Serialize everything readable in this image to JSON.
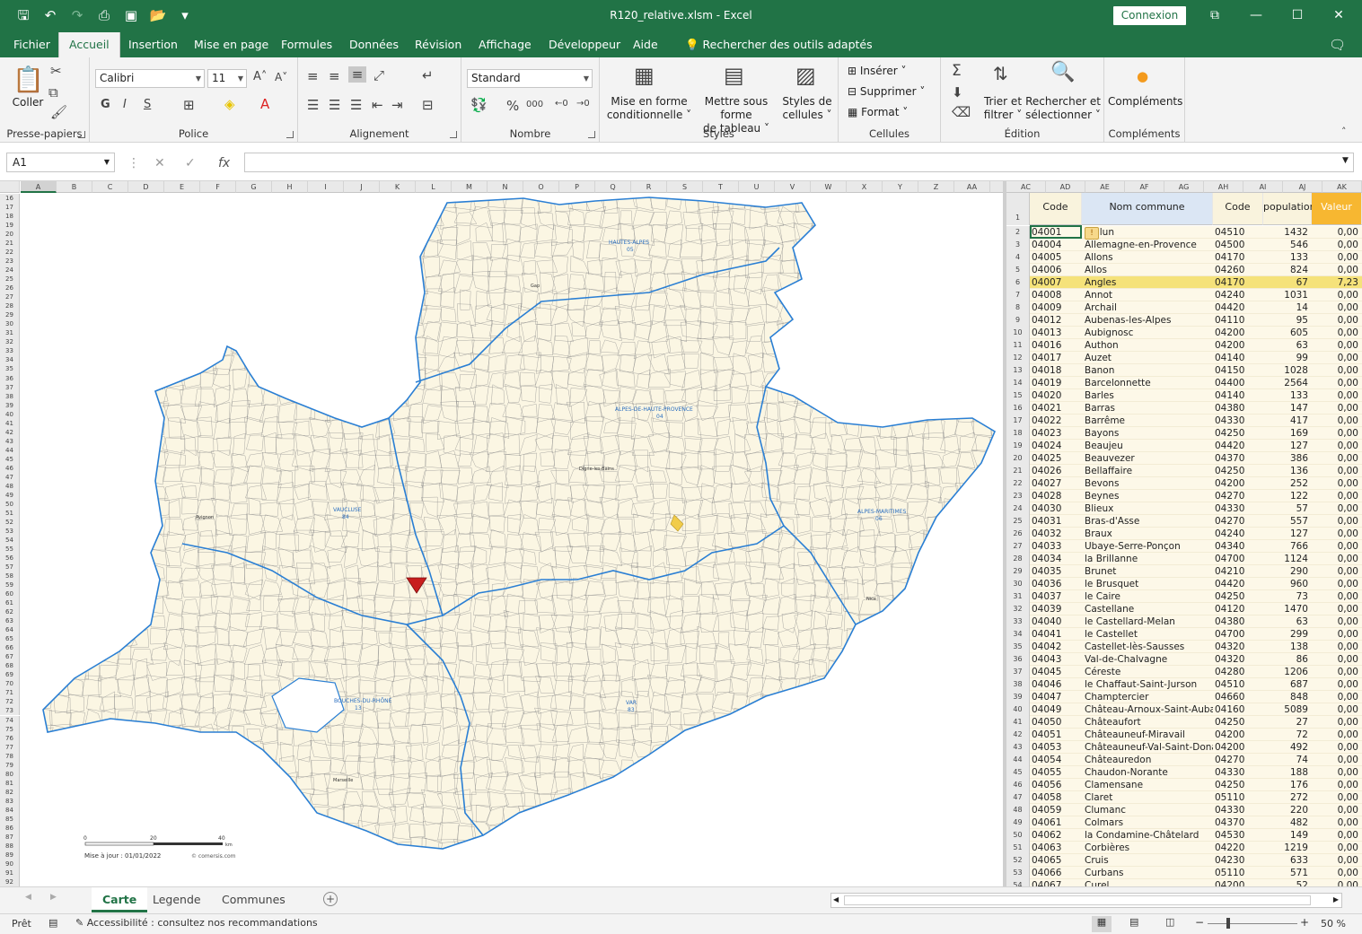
{
  "window": {
    "title": "R120_relative.xlsm  -  Excel",
    "connexion_label": "Connexion",
    "controls": [
      "⧉",
      "—",
      "☐",
      "✕"
    ]
  },
  "qat": [
    "save-icon",
    "undo-icon",
    "redo-icon",
    "print-preview-icon",
    "save-as-icon",
    "open-icon",
    "customize-icon"
  ],
  "tabs": [
    {
      "label": "Fichier",
      "active": false
    },
    {
      "label": "Accueil",
      "active": true
    },
    {
      "label": "Insertion",
      "active": false
    },
    {
      "label": "Mise en page",
      "active": false
    },
    {
      "label": "Formules",
      "active": false
    },
    {
      "label": "Données",
      "active": false
    },
    {
      "label": "Révision",
      "active": false
    },
    {
      "label": "Affichage",
      "active": false
    },
    {
      "label": "Développeur",
      "active": false
    },
    {
      "label": "Aide",
      "active": false
    }
  ],
  "search_tools": "Rechercher des outils adaptés",
  "ribbon": {
    "clipboard": {
      "label": "Presse-papiers",
      "paste": "Coller"
    },
    "font": {
      "label": "Police",
      "name": "Calibri",
      "size": "11",
      "bold": "G",
      "italic": "I",
      "underline": "S"
    },
    "alignment": {
      "label": "Alignement"
    },
    "number": {
      "label": "Nombre",
      "format": "Standard",
      "percent": "%",
      "thousands": "000"
    },
    "styles": {
      "label": "Styles",
      "cond_format": [
        "Mise en forme",
        "conditionnelle ˅"
      ],
      "format_table": [
        "Mettre sous forme",
        "de tableau ˅"
      ],
      "cell_styles": [
        "Styles de",
        "cellules ˅"
      ]
    },
    "cells": {
      "label": "Cellules",
      "insert": "Insérer",
      "delete": "Supprimer",
      "format": "Format"
    },
    "editing": {
      "label": "Édition",
      "sort": [
        "Trier et",
        "filtrer ˅"
      ],
      "find": [
        "Rechercher et",
        "sélectionner ˅"
      ]
    },
    "addins": {
      "label": "Compléments",
      "button": "Compléments"
    }
  },
  "formula_bar": {
    "name_box": "A1",
    "fx": "fx",
    "value": ""
  },
  "map_columns": [
    "A",
    "B",
    "C",
    "D",
    "E",
    "F",
    "G",
    "H",
    "I",
    "J",
    "K",
    "L",
    "M",
    "N",
    "O",
    "P",
    "Q",
    "R",
    "S",
    "T",
    "U",
    "V",
    "W",
    "X",
    "Y",
    "Z",
    "AA",
    "AB"
  ],
  "map_rows": [
    16,
    17,
    18,
    19,
    20,
    21,
    22,
    23,
    24,
    25,
    26,
    27,
    28,
    29,
    30,
    31,
    32,
    33,
    34,
    35,
    36,
    37,
    38,
    39,
    40,
    41,
    42,
    43,
    44,
    45,
    46,
    47,
    48,
    49,
    50,
    51,
    52,
    53,
    54,
    55,
    56,
    57,
    58,
    59,
    60,
    61,
    62,
    63,
    64,
    65,
    66,
    67,
    68,
    69,
    70,
    71,
    72,
    73,
    74,
    75,
    76,
    77,
    78,
    79,
    80,
    81,
    82,
    83,
    84,
    85,
    86,
    87,
    88,
    89,
    90,
    91,
    92
  ],
  "table_columns": [
    "AC",
    "AD",
    "AE",
    "AF",
    "AG",
    "AH",
    "AI",
    "AJ",
    "AK"
  ],
  "map": {
    "departments": [
      {
        "label": "HAUTES-ALPES",
        "num": "05"
      },
      {
        "label": "ALPES-DE-HAUTE-PROVENCE",
        "num": "04"
      },
      {
        "label": "VAUCLUSE",
        "num": "84"
      },
      {
        "label": "ALPES-MARITIMES",
        "num": "06"
      },
      {
        "label": "BOUCHES-DU-RHÔNE",
        "num": "13"
      },
      {
        "label": "VAR",
        "num": "83"
      }
    ],
    "scale_labels": [
      "0",
      "20",
      "40"
    ],
    "scale_unit": "km",
    "update_text": "Mise à jour : 01/01/2022",
    "copyright": "© comersis.com",
    "cities": [
      "Gap",
      "Digne-les-Bains",
      "Marseille",
      "Nice",
      "Avignon"
    ]
  },
  "table": {
    "headers": [
      "Code Insee",
      "Nom commune",
      "Code postal",
      "population",
      "Valeur"
    ],
    "rows": [
      {
        "n": "2",
        "code": "04001",
        "nom": "Aiglun",
        "cp": "04510",
        "pop": "1432",
        "val": "0,00"
      },
      {
        "n": "3",
        "code": "04004",
        "nom": "Allemagne-en-Provence",
        "cp": "04500",
        "pop": "546",
        "val": "0,00"
      },
      {
        "n": "4",
        "code": "04005",
        "nom": "Allons",
        "cp": "04170",
        "pop": "133",
        "val": "0,00"
      },
      {
        "n": "5",
        "code": "04006",
        "nom": "Allos",
        "cp": "04260",
        "pop": "824",
        "val": "0,00"
      },
      {
        "n": "6",
        "code": "04007",
        "nom": "Angles",
        "cp": "04170",
        "pop": "67",
        "val": "7,23",
        "sel": true
      },
      {
        "n": "7",
        "code": "04008",
        "nom": "Annot",
        "cp": "04240",
        "pop": "1031",
        "val": "0,00"
      },
      {
        "n": "8",
        "code": "04009",
        "nom": "Archail",
        "cp": "04420",
        "pop": "14",
        "val": "0,00"
      },
      {
        "n": "9",
        "code": "04012",
        "nom": "Aubenas-les-Alpes",
        "cp": "04110",
        "pop": "95",
        "val": "0,00"
      },
      {
        "n": "10",
        "code": "04013",
        "nom": "Aubignosc",
        "cp": "04200",
        "pop": "605",
        "val": "0,00"
      },
      {
        "n": "11",
        "code": "04016",
        "nom": "Authon",
        "cp": "04200",
        "pop": "63",
        "val": "0,00"
      },
      {
        "n": "12",
        "code": "04017",
        "nom": "Auzet",
        "cp": "04140",
        "pop": "99",
        "val": "0,00"
      },
      {
        "n": "13",
        "code": "04018",
        "nom": "Banon",
        "cp": "04150",
        "pop": "1028",
        "val": "0,00"
      },
      {
        "n": "14",
        "code": "04019",
        "nom": "Barcelonnette",
        "cp": "04400",
        "pop": "2564",
        "val": "0,00"
      },
      {
        "n": "15",
        "code": "04020",
        "nom": "Barles",
        "cp": "04140",
        "pop": "133",
        "val": "0,00"
      },
      {
        "n": "16",
        "code": "04021",
        "nom": "Barras",
        "cp": "04380",
        "pop": "147",
        "val": "0,00"
      },
      {
        "n": "17",
        "code": "04022",
        "nom": "Barrême",
        "cp": "04330",
        "pop": "417",
        "val": "0,00"
      },
      {
        "n": "18",
        "code": "04023",
        "nom": "Bayons",
        "cp": "04250",
        "pop": "169",
        "val": "0,00"
      },
      {
        "n": "19",
        "code": "04024",
        "nom": "Beaujeu",
        "cp": "04420",
        "pop": "127",
        "val": "0,00"
      },
      {
        "n": "20",
        "code": "04025",
        "nom": "Beauvezer",
        "cp": "04370",
        "pop": "386",
        "val": "0,00"
      },
      {
        "n": "21",
        "code": "04026",
        "nom": "Bellaffaire",
        "cp": "04250",
        "pop": "136",
        "val": "0,00"
      },
      {
        "n": "22",
        "code": "04027",
        "nom": "Bevons",
        "cp": "04200",
        "pop": "252",
        "val": "0,00"
      },
      {
        "n": "23",
        "code": "04028",
        "nom": "Beynes",
        "cp": "04270",
        "pop": "122",
        "val": "0,00"
      },
      {
        "n": "24",
        "code": "04030",
        "nom": "Blieux",
        "cp": "04330",
        "pop": "57",
        "val": "0,00"
      },
      {
        "n": "25",
        "code": "04031",
        "nom": "Bras-d'Asse",
        "cp": "04270",
        "pop": "557",
        "val": "0,00"
      },
      {
        "n": "26",
        "code": "04032",
        "nom": "Braux",
        "cp": "04240",
        "pop": "127",
        "val": "0,00"
      },
      {
        "n": "27",
        "code": "04033",
        "nom": "Ubaye-Serre-Ponçon",
        "cp": "04340",
        "pop": "766",
        "val": "0,00"
      },
      {
        "n": "28",
        "code": "04034",
        "nom": "la Brillanne",
        "cp": "04700",
        "pop": "1124",
        "val": "0,00"
      },
      {
        "n": "29",
        "code": "04035",
        "nom": "Brunet",
        "cp": "04210",
        "pop": "290",
        "val": "0,00"
      },
      {
        "n": "30",
        "code": "04036",
        "nom": "le Brusquet",
        "cp": "04420",
        "pop": "960",
        "val": "0,00"
      },
      {
        "n": "31",
        "code": "04037",
        "nom": "le Caire",
        "cp": "04250",
        "pop": "73",
        "val": "0,00"
      },
      {
        "n": "32",
        "code": "04039",
        "nom": "Castellane",
        "cp": "04120",
        "pop": "1470",
        "val": "0,00"
      },
      {
        "n": "33",
        "code": "04040",
        "nom": "le Castellard-Melan",
        "cp": "04380",
        "pop": "63",
        "val": "0,00"
      },
      {
        "n": "34",
        "code": "04041",
        "nom": "le Castellet",
        "cp": "04700",
        "pop": "299",
        "val": "0,00"
      },
      {
        "n": "35",
        "code": "04042",
        "nom": "Castellet-lès-Sausses",
        "cp": "04320",
        "pop": "138",
        "val": "0,00"
      },
      {
        "n": "36",
        "code": "04043",
        "nom": "Val-de-Chalvagne",
        "cp": "04320",
        "pop": "86",
        "val": "0,00"
      },
      {
        "n": "37",
        "code": "04045",
        "nom": "Céreste",
        "cp": "04280",
        "pop": "1206",
        "val": "0,00"
      },
      {
        "n": "38",
        "code": "04046",
        "nom": "le Chaffaut-Saint-Jurson",
        "cp": "04510",
        "pop": "687",
        "val": "0,00"
      },
      {
        "n": "39",
        "code": "04047",
        "nom": "Champtercier",
        "cp": "04660",
        "pop": "848",
        "val": "0,00"
      },
      {
        "n": "40",
        "code": "04049",
        "nom": "Château-Arnoux-Saint-Auban",
        "cp": "04160",
        "pop": "5089",
        "val": "0,00"
      },
      {
        "n": "41",
        "code": "04050",
        "nom": "Châteaufort",
        "cp": "04250",
        "pop": "27",
        "val": "0,00"
      },
      {
        "n": "42",
        "code": "04051",
        "nom": "Châteauneuf-Miravail",
        "cp": "04200",
        "pop": "72",
        "val": "0,00"
      },
      {
        "n": "43",
        "code": "04053",
        "nom": "Châteauneuf-Val-Saint-Donat",
        "cp": "04200",
        "pop": "492",
        "val": "0,00"
      },
      {
        "n": "44",
        "code": "04054",
        "nom": "Châteauredon",
        "cp": "04270",
        "pop": "74",
        "val": "0,00"
      },
      {
        "n": "45",
        "code": "04055",
        "nom": "Chaudon-Norante",
        "cp": "04330",
        "pop": "188",
        "val": "0,00"
      },
      {
        "n": "46",
        "code": "04056",
        "nom": "Clamensane",
        "cp": "04250",
        "pop": "176",
        "val": "0,00"
      },
      {
        "n": "47",
        "code": "04058",
        "nom": "Claret",
        "cp": "05110",
        "pop": "272",
        "val": "0,00"
      },
      {
        "n": "48",
        "code": "04059",
        "nom": "Clumanc",
        "cp": "04330",
        "pop": "220",
        "val": "0,00"
      },
      {
        "n": "49",
        "code": "04061",
        "nom": "Colmars",
        "cp": "04370",
        "pop": "482",
        "val": "0,00"
      },
      {
        "n": "50",
        "code": "04062",
        "nom": "la Condamine-Châtelard",
        "cp": "04530",
        "pop": "149",
        "val": "0,00"
      },
      {
        "n": "51",
        "code": "04063",
        "nom": "Corbières",
        "cp": "04220",
        "pop": "1219",
        "val": "0,00"
      },
      {
        "n": "52",
        "code": "04065",
        "nom": "Cruis",
        "cp": "04230",
        "pop": "633",
        "val": "0,00"
      },
      {
        "n": "53",
        "code": "04066",
        "nom": "Curbans",
        "cp": "05110",
        "pop": "571",
        "val": "0,00"
      },
      {
        "n": "54",
        "code": "04067",
        "nom": "Curel",
        "cp": "04200",
        "pop": "52",
        "val": "0,00"
      }
    ]
  },
  "sheets": [
    {
      "label": "Carte",
      "active": true
    },
    {
      "label": "Legende",
      "active": false
    },
    {
      "label": "Communes",
      "active": false
    }
  ],
  "status": {
    "ready": "Prêt",
    "accessibility": "Accessibilité : consultez nos recommandations",
    "zoom": "50 %"
  },
  "colors": {
    "brand": "#217346",
    "map_fill": "#fbf6e3",
    "map_border": "#2a7fd4",
    "highlight": "#c81e1e",
    "selected_row": "#f5e27a",
    "valeur_header": "#f7b731"
  }
}
